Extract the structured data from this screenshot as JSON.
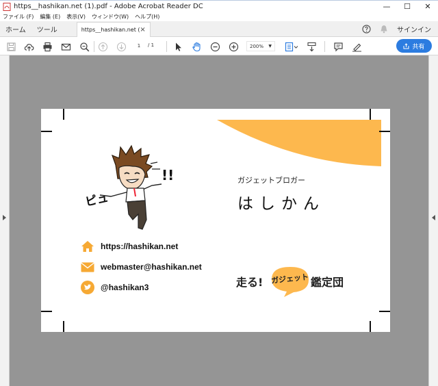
{
  "window": {
    "title": "https__hashikan.net (1).pdf - Adobe Acrobat Reader DC",
    "minimize": "—",
    "maximize": "☐",
    "close": "✕"
  },
  "menu": [
    "ファイル (F)",
    "編集 (E)",
    "表示(V)",
    "ウィンドウ(W)",
    "ヘルプ(H)"
  ],
  "tabs": {
    "home": "ホーム",
    "tools": "ツール",
    "document": "https__hashikan.net (...",
    "close": "×",
    "signin": "サインイン"
  },
  "toolbar": {
    "page_current": "1",
    "page_total": "/ 1",
    "zoom": "200%",
    "share_label": "共有"
  },
  "card": {
    "subtitle": "ガジェットブロガー",
    "name": "はしかん",
    "contacts": [
      {
        "icon": "home-icon",
        "text": "https://hashikan.net"
      },
      {
        "icon": "mail-icon",
        "text": "webmaster@hashikan.net"
      },
      {
        "icon": "twitter-icon",
        "text": "@hashikan3"
      }
    ],
    "character_text": {
      "pyu": "ピュ",
      "exclaim": "!!"
    },
    "logo": {
      "run": "走る!",
      "gadget": "ガジェット",
      "rest": "鑑定団"
    },
    "colors": {
      "accent": "#FDB84E",
      "icon_orange": "#F6A934"
    }
  }
}
